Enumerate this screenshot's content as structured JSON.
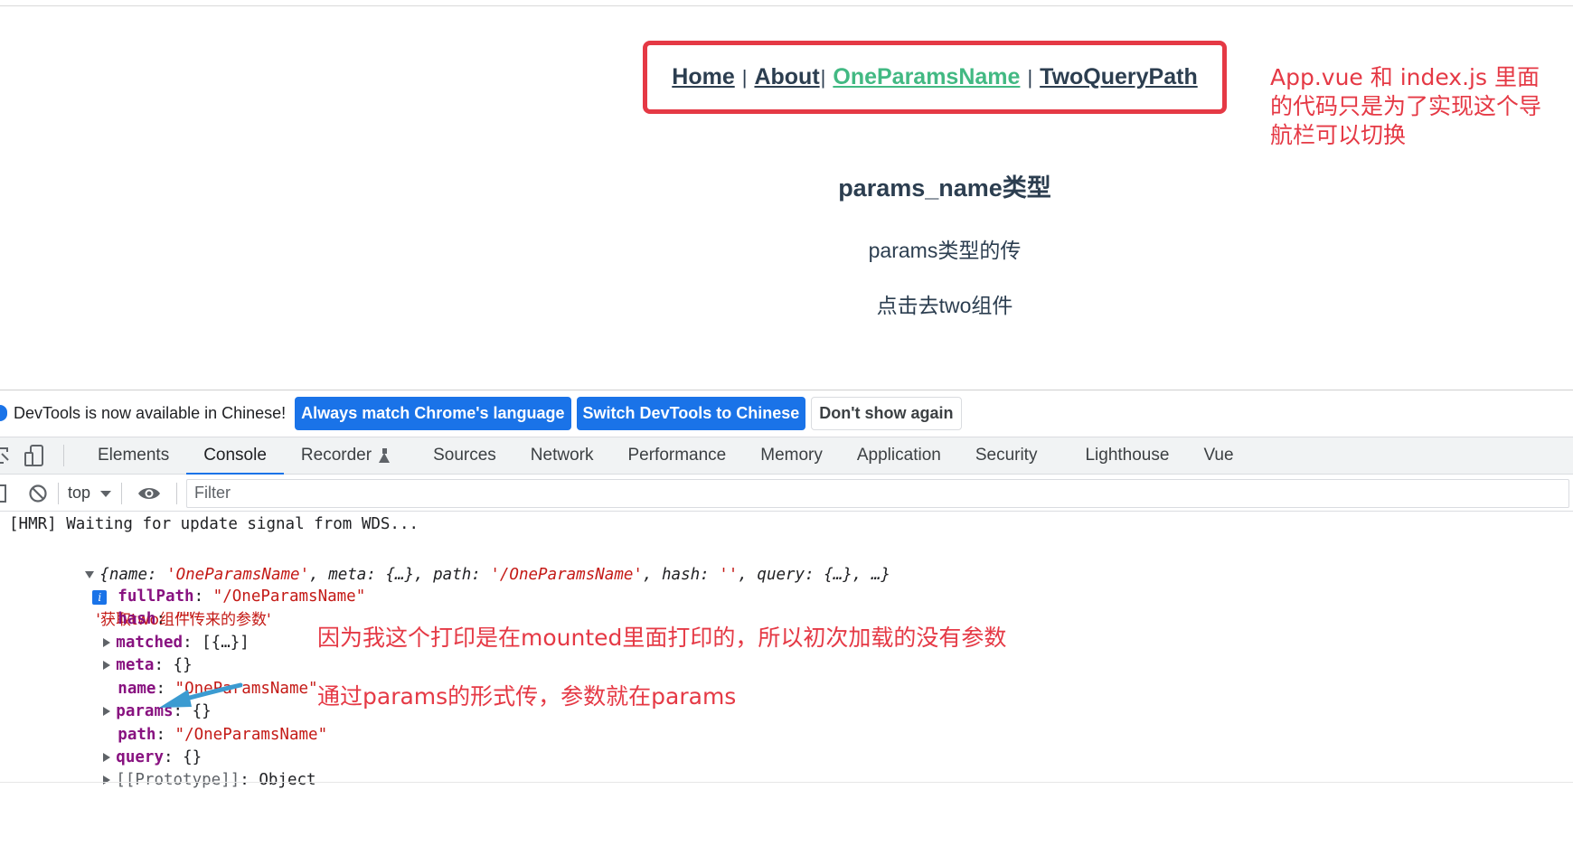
{
  "app": {
    "nav": {
      "links": [
        "Home",
        "About",
        "OneParamsName",
        "TwoQueryPath"
      ],
      "separators": [
        "|",
        "|",
        "|"
      ]
    },
    "heading": "params_name类型",
    "paragraphs": [
      "params类型的传",
      "点击去two组件"
    ]
  },
  "annotations": {
    "nav_note": "App.vue 和 index.js 里面的代码只是为了实现这个导航栏可以切换",
    "console_note_1": "因为我这个打印是在mounted里面打印的，所以初次加载的没有参数",
    "console_note_2": "通过params的形式传，参数就在params",
    "colors": {
      "note": "#e53945",
      "arrow": "#3b9bd1"
    }
  },
  "devtools": {
    "infobar": {
      "message": "DevTools is now available in Chinese!",
      "btn_match": "Always match Chrome's language",
      "btn_switch": "Switch DevTools to Chinese",
      "btn_dismiss": "Don't show again"
    },
    "tabs": [
      "Elements",
      "Console",
      "Recorder",
      "Sources",
      "Network",
      "Performance",
      "Memory",
      "Application",
      "Security",
      "Lighthouse",
      "Vue"
    ],
    "active_tab": "Console",
    "filterbar": {
      "context": "top",
      "filter_placeholder": "Filter"
    },
    "console": {
      "hmr": "[HMR] Waiting for update signal from WDS...",
      "summary": {
        "open": "{",
        "k_name": "name",
        "v_name": "'OneParamsName'",
        "k_meta": "meta",
        "v_meta": "{…}",
        "k_path": "path",
        "v_path": "'/OneParamsName'",
        "k_hash": "hash",
        "v_hash": "''",
        "k_query": "query",
        "v_query": "{…}",
        "tail": "…}",
        "info": "i",
        "label": "'获取two组件传来的参数'"
      },
      "props": [
        {
          "key": "fullPath",
          "value": "\"/OneParamsName\""
        },
        {
          "key": "hash",
          "value": "\"\""
        },
        {
          "key": "matched",
          "value": "[{…}]"
        },
        {
          "key": "meta",
          "value": "{}"
        },
        {
          "key": "name",
          "value": "\"OneParamsName\""
        },
        {
          "key": "params",
          "value": "{}"
        },
        {
          "key": "path",
          "value": "\"/OneParamsName\""
        },
        {
          "key": "query",
          "value": "{}"
        },
        {
          "key": "[[Prototype]]",
          "value": "Object"
        }
      ]
    }
  }
}
